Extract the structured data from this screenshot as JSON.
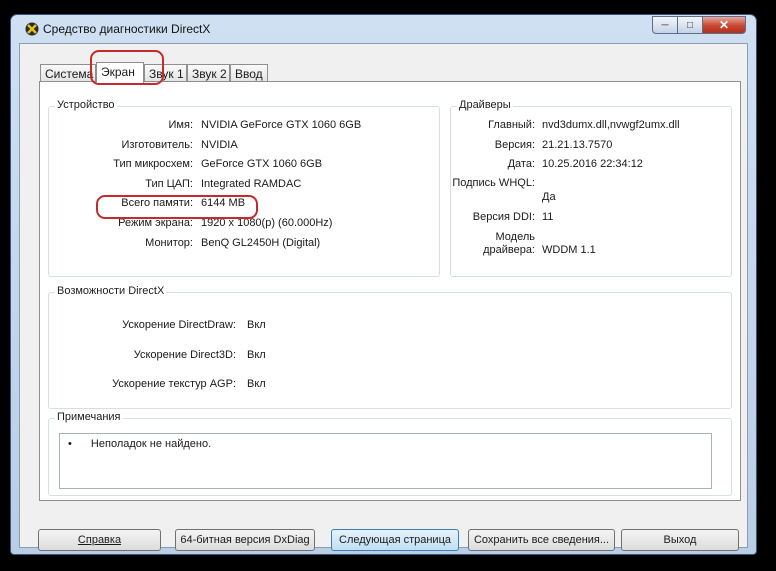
{
  "window": {
    "title": "Средство диагностики DirectX"
  },
  "tabs": [
    {
      "label": "Система"
    },
    {
      "label": "Экран"
    },
    {
      "label": "Звук 1"
    },
    {
      "label": "Звук 2"
    },
    {
      "label": "Ввод"
    }
  ],
  "device": {
    "title": "Устройство",
    "rows": [
      {
        "label": "Имя:",
        "value": "NVIDIA GeForce GTX 1060 6GB"
      },
      {
        "label": "Изготовитель:",
        "value": "NVIDIA"
      },
      {
        "label": "Тип микросхем:",
        "value": "GeForce GTX 1060 6GB"
      },
      {
        "label": "Тип ЦАП:",
        "value": "Integrated RAMDAC"
      },
      {
        "label": "Всего памяти:",
        "value": "6144 MB"
      },
      {
        "label": "Режим экрана:",
        "value": "1920 x 1080(р) (60.000Hz)"
      },
      {
        "label": "Монитор:",
        "value": "BenQ GL2450H (Digital)"
      }
    ]
  },
  "drivers": {
    "title": "Драйверы",
    "rows": [
      {
        "label": "Главный:",
        "value": "nvd3dumx.dll,nvwgf2umx.dll"
      },
      {
        "label": "Версия:",
        "value": "21.21.13.7570"
      },
      {
        "label": "Дата:",
        "value": "10.25.2016  22:34:12"
      },
      {
        "label": "Подпись WHQL:",
        "value": "Да"
      },
      {
        "label": "Версия DDI:",
        "value": "11"
      },
      {
        "label": "Модель драйвера:",
        "value": "WDDM 1.1"
      }
    ],
    "model_label_line1": "Модель",
    "model_label_line2": "драйвера:"
  },
  "directx": {
    "title": "Возможности DirectX",
    "rows": [
      {
        "label": "Ускорение DirectDraw:",
        "value": "Вкл"
      },
      {
        "label": "Ускорение Direct3D:",
        "value": "Вкл"
      },
      {
        "label": "Ускорение текстур AGP:",
        "value": "Вкл"
      }
    ]
  },
  "notes": {
    "title": "Примечания",
    "bullet": "•",
    "text": "Неполадок не найдено."
  },
  "buttons": {
    "help": "Справка",
    "dxdiag64": "64-битная версия DxDiag",
    "next": "Следующая страница",
    "save": "Сохранить все сведения...",
    "exit": "Выход"
  },
  "icons": {
    "app": "directx-icon",
    "minimize": "minimize-icon",
    "maximize": "maximize-icon",
    "close": "close-icon"
  },
  "colors": {
    "highlight_ring": "#c62a2a",
    "window_frame": "#b9cde5"
  }
}
